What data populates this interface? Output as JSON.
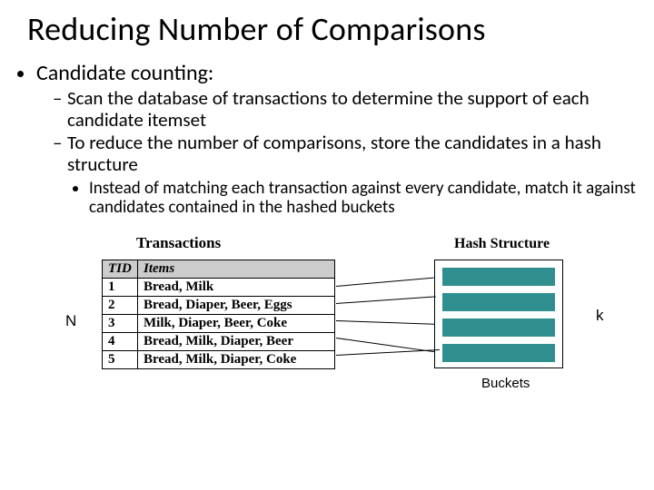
{
  "title": "Reducing Number of Comparisons",
  "bullets": {
    "l1": "Candidate counting:",
    "l2a": "Scan the database of transactions to determine the support of each candidate itemset",
    "l2b": "To reduce the number of comparisons, store the candidates in a hash structure",
    "l3": "Instead of matching each transaction against every candidate, match it against candidates contained in the hashed buckets"
  },
  "diagram": {
    "transactions_label": "Transactions",
    "hash_label": "Hash Structure",
    "buckets_label": "Buckets",
    "n_label": "N",
    "k_label": "k",
    "table": {
      "headers": {
        "tid": "TID",
        "items": "Items"
      },
      "rows": [
        {
          "tid": "1",
          "items": "Bread, Milk"
        },
        {
          "tid": "2",
          "items": "Bread, Diaper, Beer, Eggs"
        },
        {
          "tid": "3",
          "items": "Milk, Diaper, Beer, Coke"
        },
        {
          "tid": "4",
          "items": "Bread, Milk, Diaper, Beer"
        },
        {
          "tid": "5",
          "items": "Bread, Milk, Diaper, Coke"
        }
      ]
    }
  }
}
